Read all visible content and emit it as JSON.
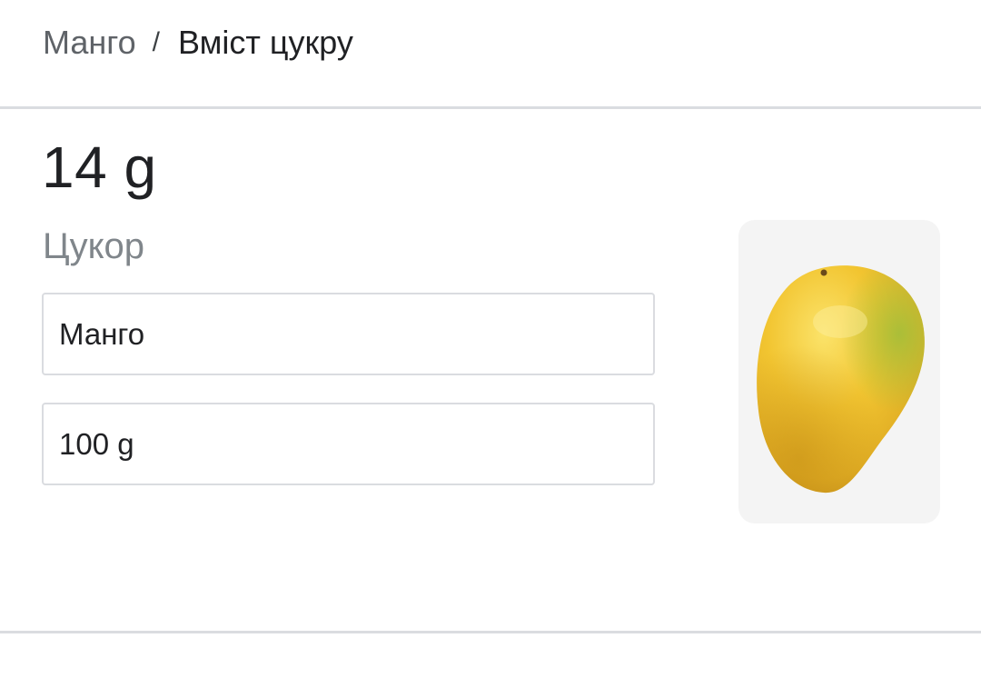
{
  "breadcrumb": {
    "parent": "Манго",
    "separator": "/",
    "current": "Вміст цукру"
  },
  "result": {
    "value": "14 g",
    "nutrient": "Цукор"
  },
  "inputs": {
    "food": "Манго",
    "amount": "100 g"
  },
  "image": {
    "subject": "mango-image",
    "colors": {
      "body": "#f2c531",
      "shade": "#d9a322",
      "highlight": "#fbe36a",
      "green_tint": "#b8c43a"
    }
  }
}
